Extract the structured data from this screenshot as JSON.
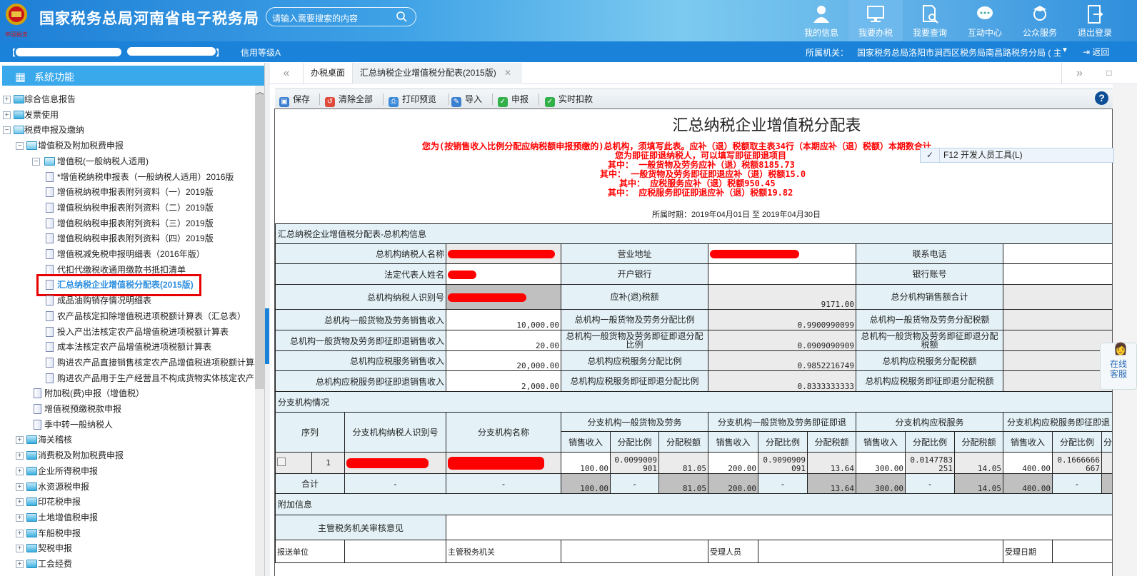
{
  "header": {
    "site_title": "国家税务总局河南省电子税务局",
    "logo_text": "中国税务",
    "search_placeholder": "请输入需要搜索的内容",
    "nav": [
      {
        "label": "我的信息",
        "icon": "user-icon"
      },
      {
        "label": "我要办税",
        "icon": "monitor-icon",
        "active": true
      },
      {
        "label": "我要查询",
        "icon": "document-search-icon"
      },
      {
        "label": "互动中心",
        "icon": "chat-icon"
      },
      {
        "label": "公众服务",
        "icon": "service-person-icon"
      },
      {
        "label": "退出登录",
        "icon": "logout-icon"
      }
    ],
    "credit_rating": "信用等级A",
    "bracket_open": "【",
    "bracket_close": "】",
    "authority_label": "所属机关：",
    "authority_value": "国家税务总局洛阳市涧西区税务局南昌路税务分局 ( 主",
    "back_label": "返回"
  },
  "sidebar": {
    "title": "系统功能",
    "items": [
      {
        "level": 0,
        "toggle": "+",
        "kind": "folder",
        "label": "综合信息报告"
      },
      {
        "level": 0,
        "toggle": "+",
        "kind": "folder",
        "label": "发票使用"
      },
      {
        "level": 0,
        "toggle": "-",
        "kind": "open",
        "label": "税费申报及缴纳"
      },
      {
        "level": 1,
        "toggle": "-",
        "kind": "open",
        "label": "增值税及附加税费申报"
      },
      {
        "level": 2,
        "toggle": "-",
        "kind": "open",
        "label": "增值税(一般纳税人适用)"
      },
      {
        "level": 3,
        "kind": "file",
        "label": "*增值税纳税申报表（一般纳税人适用）2016版"
      },
      {
        "level": 3,
        "kind": "file",
        "label": "增值税纳税申报表附列资料（一）2019版"
      },
      {
        "level": 3,
        "kind": "file",
        "label": "增值税纳税申报表附列资料（二）2019版"
      },
      {
        "level": 3,
        "kind": "file",
        "label": "增值税纳税申报表附列资料（三）2019版"
      },
      {
        "level": 3,
        "kind": "file",
        "label": "增值税纳税申报表附列资料（四）2019版"
      },
      {
        "level": 3,
        "kind": "file",
        "label": "增值税减免税申报明细表（2016年版）"
      },
      {
        "level": 3,
        "kind": "file",
        "label": "代扣代缴税收通用缴款书抵扣清单"
      },
      {
        "level": 3,
        "kind": "file",
        "label": "汇总纳税企业增值税分配表(2015版)",
        "selected": true
      },
      {
        "level": 3,
        "kind": "file",
        "label": "成品油购销存情况明细表"
      },
      {
        "level": 3,
        "kind": "file",
        "label": "农产品核定扣除增值税进项税额计算表（汇总表）"
      },
      {
        "level": 3,
        "kind": "file",
        "label": "投入产出法核定农产品增值税进项税额计算表"
      },
      {
        "level": 3,
        "kind": "file",
        "label": "成本法核定农产品增值税进项税额计算表"
      },
      {
        "level": 3,
        "kind": "file",
        "label": "购进农产品直接销售核定农产品增值税进项税额计算表"
      },
      {
        "level": 3,
        "kind": "file",
        "label": "购进农产品用于生产经营且不构成货物实体核定农产品增值税进项税额计算表"
      },
      {
        "level": 2,
        "kind": "file",
        "label": "附加税(费)申报（增值税）"
      },
      {
        "level": 2,
        "kind": "file",
        "label": "增值税预缴税款申报"
      },
      {
        "level": 2,
        "kind": "file",
        "label": "季中转一般纳税人"
      },
      {
        "level": 1,
        "toggle": "+",
        "kind": "folder",
        "label": "海关稽核"
      },
      {
        "level": 1,
        "toggle": "+",
        "kind": "folder",
        "label": "消费税及附加税费申报"
      },
      {
        "level": 1,
        "toggle": "+",
        "kind": "folder",
        "label": "企业所得税申报"
      },
      {
        "level": 1,
        "toggle": "+",
        "kind": "folder",
        "label": "水资源税申报"
      },
      {
        "level": 1,
        "toggle": "+",
        "kind": "folder",
        "label": "印花税申报"
      },
      {
        "level": 1,
        "toggle": "+",
        "kind": "folder",
        "label": "土地增值税申报"
      },
      {
        "level": 1,
        "toggle": "+",
        "kind": "folder",
        "label": "车船税申报"
      },
      {
        "level": 1,
        "toggle": "+",
        "kind": "folder",
        "label": "契税申报"
      },
      {
        "level": 1,
        "toggle": "+",
        "kind": "folder",
        "label": "工会经费"
      }
    ]
  },
  "tabs": {
    "home": "办税桌面",
    "active": "汇总纳税企业增值税分配表(2015版)"
  },
  "toolbar": {
    "save": "保存",
    "clear_all": "清除全部",
    "print_preview": "打印预览",
    "import": "导入",
    "declare": "申报",
    "realtime_deduct": "实时扣款"
  },
  "context_menu": {
    "item": "F12 开发人员工具(L)"
  },
  "online_service": [
    "在线",
    "客服"
  ],
  "form": {
    "title": "汇总纳税企业增值税分配表",
    "notices": [
      "您为(按销售收入比例分配应纳税额申报预缴的)总机构，须填写此表。应补（退）税额取主表34行（本期应补（退）税额）本期数合计",
      "您为即征即退纳税人，可以填写即征即退项目",
      "其中： 一般货物及劳务应补（退）税额8185.73",
      "其中： 一般货物及劳务即征即退应补（退）税额15.0",
      "其中：  应税服务应补（退）税额950.45",
      "其中： 应税服务即征即退应补（退）税额19.82"
    ],
    "period": "所属时期：2019年04月01日 至 2019年04月30日",
    "hq_section": "汇总纳税企业增值税分配表-总机构信息",
    "hq_rows": [
      [
        "总机构纳税人名称",
        "",
        "营业地址",
        "",
        "联系电话",
        ""
      ],
      [
        "法定代表人姓名",
        "",
        "开户银行",
        "",
        "银行账号",
        ""
      ],
      [
        "总机构纳税人识别号",
        "",
        "应补(退)税额",
        "9171.00",
        "总分机构销售额合计",
        ""
      ],
      [
        "总机构一般货物及劳务销售收入",
        "10,000.00",
        "总机构一般货物及劳务分配比例",
        "0.9900990099",
        "总机构一般货物及劳务分配税额",
        ""
      ],
      [
        "总机构一般货物及劳务即征即退销售收入",
        "20.00",
        "总机构一般货物及劳务即征即退分配比例",
        "0.0909090909",
        "总机构一般货物及劳务即征即退分配税额",
        ""
      ],
      [
        "总机构应税服务销售收入",
        "20,000.00",
        "总机构应税服务分配比例",
        "0.9852216749",
        "总机构应税服务分配税额",
        ""
      ],
      [
        "总机构应税服务即征即退销售收入",
        "2,000.00",
        "总机构应税服务即征即退分配比例",
        "0.8333333333",
        "总机构应税服务即征即退分配税额",
        ""
      ]
    ],
    "branch_section": "分支机构情况",
    "branch_headers": {
      "seq": "序列",
      "tin": "分支机构纳税人识别号",
      "name": "分支机构名称",
      "groups": [
        "分支机构一般货物及劳务",
        "分支机构一般货物及劳务即征即退",
        "分支机构应税服务",
        "分支机构应税服务即征即退"
      ],
      "sub": [
        "销售收入",
        "分配比例",
        "分配税额"
      ]
    },
    "branch_rows": [
      {
        "seq": "1",
        "values": [
          "100.00",
          "0.0099009901",
          "81.05",
          "200.00",
          "0.9090909091",
          "13.64",
          "300.00",
          "0.0147783251",
          "14.05",
          "400.00",
          "0.1666666667",
          ""
        ]
      }
    ],
    "total_row": {
      "label": "合计",
      "dash": "-",
      "values": [
        "100.00",
        "-",
        "81.05",
        "200.00",
        "-",
        "13.64",
        "300.00",
        "-",
        "14.05",
        "400.00",
        "-",
        ""
      ]
    },
    "extra_section": "附加信息",
    "review_label": "主管税务机关审核意见",
    "submit_unit": "报送单位",
    "tax_authority": "主管税务机关",
    "receiver": "受理人员",
    "receive_date": "受理日期"
  }
}
